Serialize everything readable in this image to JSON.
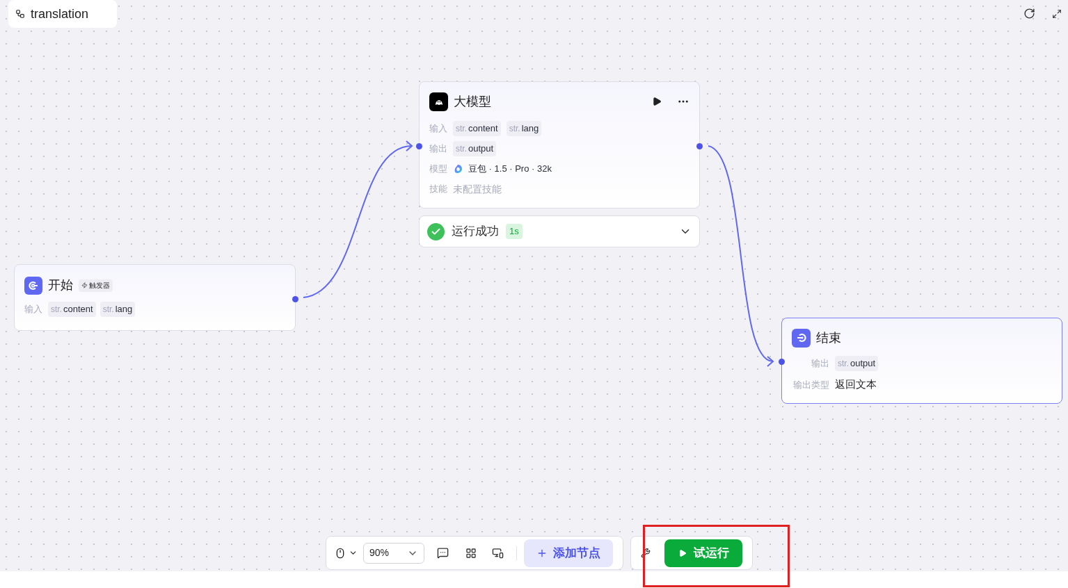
{
  "title": "translation",
  "start_node": {
    "title": "开始",
    "badge": "触发器",
    "input_label": "输入",
    "inputs": [
      {
        "type": "str.",
        "name": "content"
      },
      {
        "type": "str.",
        "name": "lang"
      }
    ]
  },
  "llm_node": {
    "title": "大模型",
    "input_label": "输入",
    "inputs": [
      {
        "type": "str.",
        "name": "content"
      },
      {
        "type": "str.",
        "name": "lang"
      }
    ],
    "output_label": "输出",
    "outputs": [
      {
        "type": "str.",
        "name": "output"
      }
    ],
    "model_label": "模型",
    "model": "豆包 · 1.5 · Pro · 32k",
    "skill_label": "技能",
    "skill": "未配置技能"
  },
  "run_status": {
    "text": "运行成功",
    "time": "1s"
  },
  "end_node": {
    "title": "结束",
    "selected": true,
    "output_label": "输出",
    "outputs": [
      {
        "type": "str.",
        "name": "output"
      }
    ],
    "output_type_label": "输出类型",
    "output_type": "返回文本"
  },
  "toolbar": {
    "zoom": "90%",
    "add_node": "添加节点",
    "run": "试运行"
  }
}
